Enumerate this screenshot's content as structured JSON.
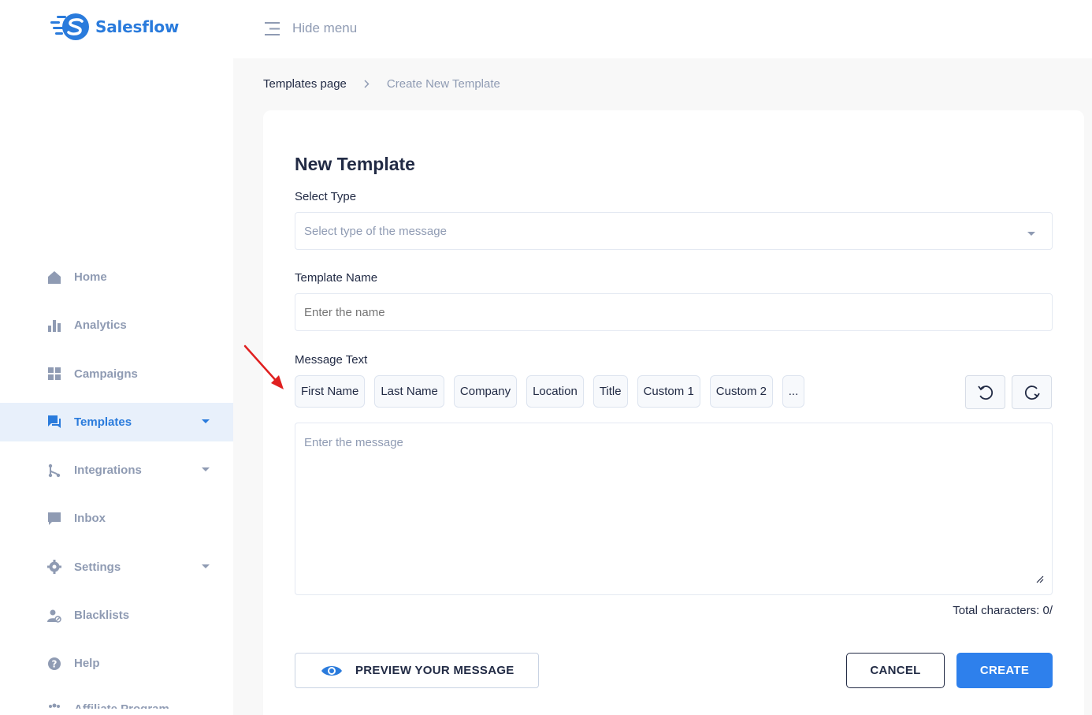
{
  "app": {
    "name": "Salesflow"
  },
  "colors": {
    "accent": "#2e80ec",
    "brand": "#2a7bdc",
    "muted": "#8f9bb3",
    "text": "#222b45",
    "annotation_arrow": "#e02020"
  },
  "sidebar": {
    "items": [
      {
        "label": "Home",
        "icon": "home-icon",
        "active": false,
        "has_dropdown": false
      },
      {
        "label": "Analytics",
        "icon": "bar-chart-icon",
        "active": false,
        "has_dropdown": false
      },
      {
        "label": "Campaigns",
        "icon": "grid-icon",
        "active": false,
        "has_dropdown": false
      },
      {
        "label": "Templates",
        "icon": "chat-bubbles-icon",
        "active": true,
        "has_dropdown": true
      },
      {
        "label": "Integrations",
        "icon": "git-branch-icon",
        "active": false,
        "has_dropdown": true
      },
      {
        "label": "Inbox",
        "icon": "message-icon",
        "active": false,
        "has_dropdown": false
      },
      {
        "label": "Settings",
        "icon": "gear-icon",
        "active": false,
        "has_dropdown": true
      },
      {
        "label": "Blacklists",
        "icon": "user-block-icon",
        "active": false,
        "has_dropdown": false
      },
      {
        "label": "Help",
        "icon": "question-circle-icon",
        "active": false,
        "has_dropdown": false
      },
      {
        "label": "Affiliate Program",
        "icon": "people-icon",
        "active": false,
        "has_dropdown": false
      }
    ]
  },
  "topbar": {
    "hide_menu_label": "Hide menu"
  },
  "breadcrumb": {
    "parent": "Templates page",
    "current": "Create New Template"
  },
  "form": {
    "title": "New Template",
    "select_type": {
      "label": "Select Type",
      "placeholder": "Select type of the message"
    },
    "template_name": {
      "label": "Template Name",
      "placeholder": "Enter the name"
    },
    "message_text": {
      "label": "Message Text",
      "placeholder": "Enter the message",
      "tags": [
        "First Name",
        "Last Name",
        "Company",
        "Location",
        "Title",
        "Custom 1",
        "Custom 2",
        "..."
      ],
      "total_label": "Total characters: 0/"
    },
    "buttons": {
      "preview": "PREVIEW YOUR MESSAGE",
      "cancel": "CANCEL",
      "create": "CREATE"
    }
  }
}
